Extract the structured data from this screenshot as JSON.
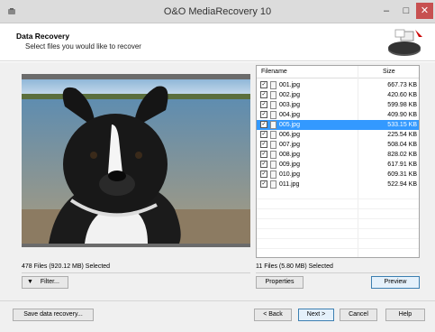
{
  "window": {
    "title": "O&O MediaRecovery 10",
    "minimize_glyph": "–",
    "maximize_glyph": "□",
    "close_glyph": "✕"
  },
  "header": {
    "title": "Data Recovery",
    "subtitle": "Select files you would like to recover"
  },
  "filelist": {
    "col_filename": "Filename",
    "col_size": "Size",
    "rows": [
      {
        "name": "001.jpg",
        "size": "667.73 KB",
        "checked": true,
        "selected": false
      },
      {
        "name": "002.jpg",
        "size": "420.60 KB",
        "checked": true,
        "selected": false
      },
      {
        "name": "003.jpg",
        "size": "599.98 KB",
        "checked": true,
        "selected": false
      },
      {
        "name": "004.jpg",
        "size": "409.90 KB",
        "checked": true,
        "selected": false
      },
      {
        "name": "005.jpg",
        "size": "533.15 KB",
        "checked": true,
        "selected": true
      },
      {
        "name": "006.jpg",
        "size": "225.54 KB",
        "checked": true,
        "selected": false
      },
      {
        "name": "007.jpg",
        "size": "508.04 KB",
        "checked": true,
        "selected": false
      },
      {
        "name": "008.jpg",
        "size": "828.02 KB",
        "checked": true,
        "selected": false
      },
      {
        "name": "009.jpg",
        "size": "617.91 KB",
        "checked": true,
        "selected": false
      },
      {
        "name": "010.jpg",
        "size": "609.31 KB",
        "checked": true,
        "selected": false
      },
      {
        "name": "011.jpg",
        "size": "522.94 KB",
        "checked": true,
        "selected": false
      }
    ]
  },
  "status": {
    "left": "478 Files (920.12 MB) Selected",
    "right": "11 Files (5.80 MB) Selected"
  },
  "buttons": {
    "filter": "Filter...",
    "properties": "Properties",
    "preview": "Preview",
    "save": "Save data recovery...",
    "back": "< Back",
    "next": "Next >",
    "cancel": "Cancel",
    "help": "Help"
  },
  "colors": {
    "selection": "#3399ff",
    "close_button": "#c75050"
  },
  "icons": {
    "check": "✓",
    "filter_arrow": "▼"
  }
}
